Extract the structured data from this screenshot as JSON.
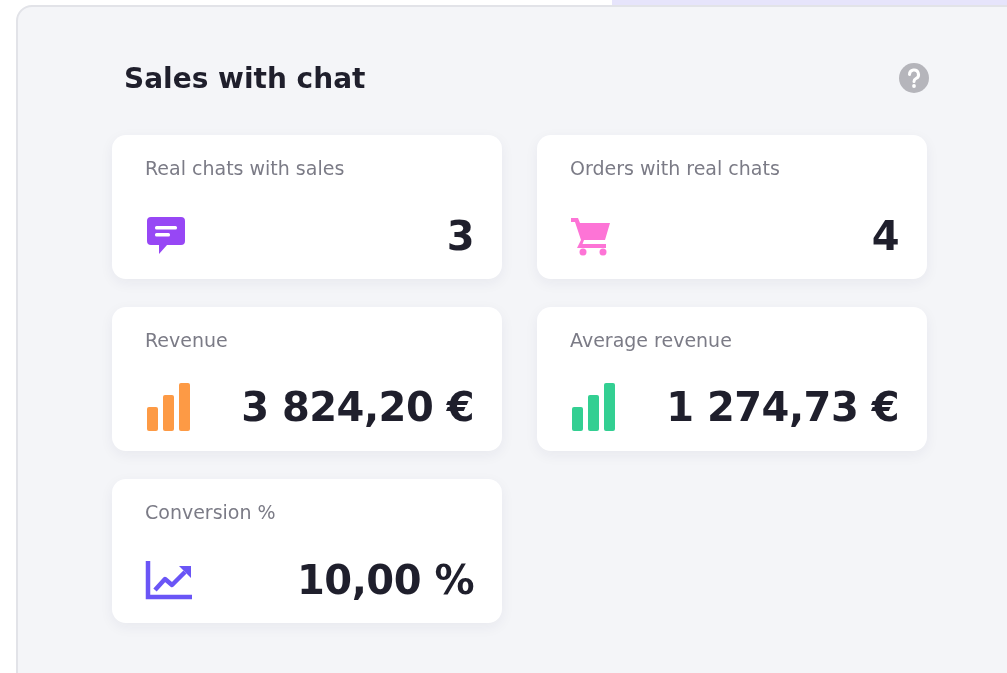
{
  "panel": {
    "title": "Sales with chat"
  },
  "cards": [
    {
      "label": "Real chats with sales",
      "value": "3",
      "kind": "chat",
      "color": "#9747f5"
    },
    {
      "label": "Orders with real chats",
      "value": "4",
      "kind": "cart",
      "color": "#fd74d6"
    },
    {
      "label": "Revenue",
      "value": "3 824,20 €",
      "kind": "bars",
      "color": "#fd9a45"
    },
    {
      "label": "Average revenue",
      "value": "1 274,73 €",
      "kind": "bars",
      "color": "#33cf92"
    },
    {
      "label": "Conversion %",
      "value": "10,00 %",
      "kind": "trend",
      "color": "#6a55f6"
    }
  ]
}
